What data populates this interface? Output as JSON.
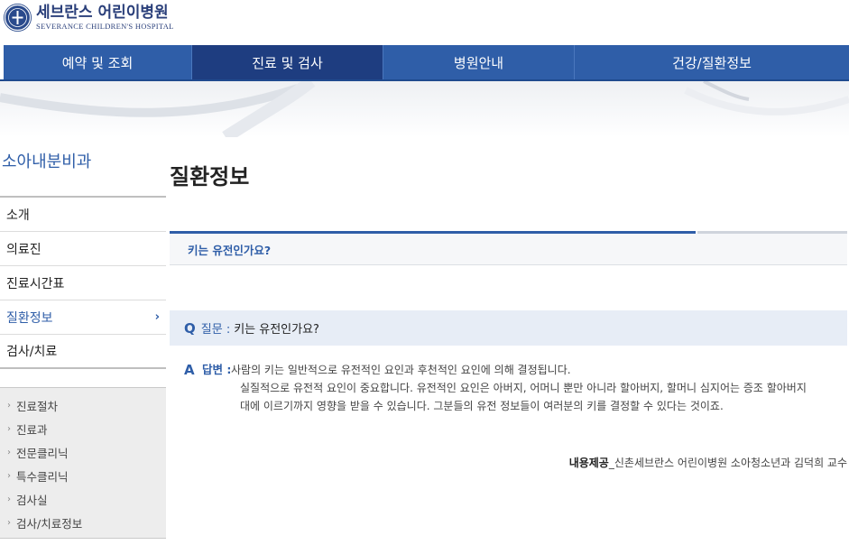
{
  "logo": {
    "name_ko": "세브란스 어린이병원",
    "name_en": "SEVERANCE CHILDREN'S HOSPITAL"
  },
  "gnb": {
    "items": [
      {
        "label": "예약 및 조회"
      },
      {
        "label": "진료 및 검사"
      },
      {
        "label": "병원안내"
      },
      {
        "label": "건강/질환정보"
      }
    ],
    "active_index": 1
  },
  "lnb": {
    "title": "소아내분비과",
    "items": [
      {
        "label": "소개"
      },
      {
        "label": "의료진"
      },
      {
        "label": "진료시간표"
      },
      {
        "label": "질환정보",
        "chevron": "›"
      },
      {
        "label": "검사/치료"
      }
    ],
    "sub_items": [
      {
        "label": "진료절차"
      },
      {
        "label": "진료과"
      },
      {
        "label": "전문클리닉"
      },
      {
        "label": "특수클리닉"
      },
      {
        "label": "검사실"
      },
      {
        "label": "검사/치료정보"
      }
    ],
    "bullet": "›"
  },
  "content": {
    "page_title": "질환정보",
    "subject": "키는 유전인가요?",
    "question": {
      "mark": "Q",
      "label": "질문 :",
      "text": "키는 유전인가요?"
    },
    "answer": {
      "mark": "A",
      "label": "답변 :",
      "lines": [
        "사람의 키는 일반적으로 유전적인 요인과 후천적인 요인에 의해 결정됩니다.",
        "실질적으로 유전적 요인이 중요합니다. 유전적인 요인은 아버지, 어머니 뿐만 아니라 할아버지, 할머니 심지어는 증조 할아버지",
        "대에 이르기까지 영향을 받을 수 있습니다. 그분들의 유전 정보들이 여러분의 키를 결정할 수 있다는 것이죠."
      ]
    },
    "credit": {
      "label": "내용제공",
      "text": "_신촌세브란스 어린이병원 소아청소년과 김덕희 교수"
    }
  },
  "colors": {
    "brand_blue": "#2f5ea8",
    "nav_active": "#1e3d80",
    "question_bg": "#e7edf6"
  }
}
